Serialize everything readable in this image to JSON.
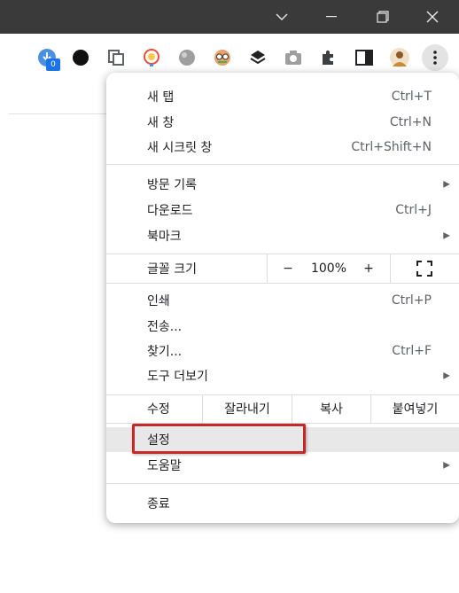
{
  "window": {
    "controls": {
      "dropdown": "⌄",
      "minimize": "—",
      "restore": "❐",
      "close": "✕"
    }
  },
  "toolbar": {
    "extension_badge": "0",
    "es_label": "ES",
    "menu_icon": "⋮"
  },
  "menu": {
    "new_tab": {
      "label": "새 탭",
      "shortcut": "Ctrl+T"
    },
    "new_window": {
      "label": "새 창",
      "shortcut": "Ctrl+N"
    },
    "new_incognito": {
      "label": "새 시크릿 창",
      "shortcut": "Ctrl+Shift+N"
    },
    "history": {
      "label": "방문 기록"
    },
    "downloads": {
      "label": "다운로드",
      "shortcut": "Ctrl+J"
    },
    "bookmarks": {
      "label": "북마크"
    },
    "zoom": {
      "label": "글꼴 크기",
      "minus": "−",
      "value": "100%",
      "plus": "+"
    },
    "print": {
      "label": "인쇄",
      "shortcut": "Ctrl+P"
    },
    "cast": {
      "label": "전송..."
    },
    "find": {
      "label": "찾기...",
      "shortcut": "Ctrl+F"
    },
    "more_tools": {
      "label": "도구 더보기"
    },
    "edit": {
      "label": "수정",
      "cut": "잘라내기",
      "copy": "복사",
      "paste": "붙여넣기"
    },
    "settings": {
      "label": "설정"
    },
    "help": {
      "label": "도움말"
    },
    "exit": {
      "label": "종료"
    }
  },
  "colors": {
    "highlight_border": "#c62828",
    "titlebar": "#3a3a3a"
  }
}
